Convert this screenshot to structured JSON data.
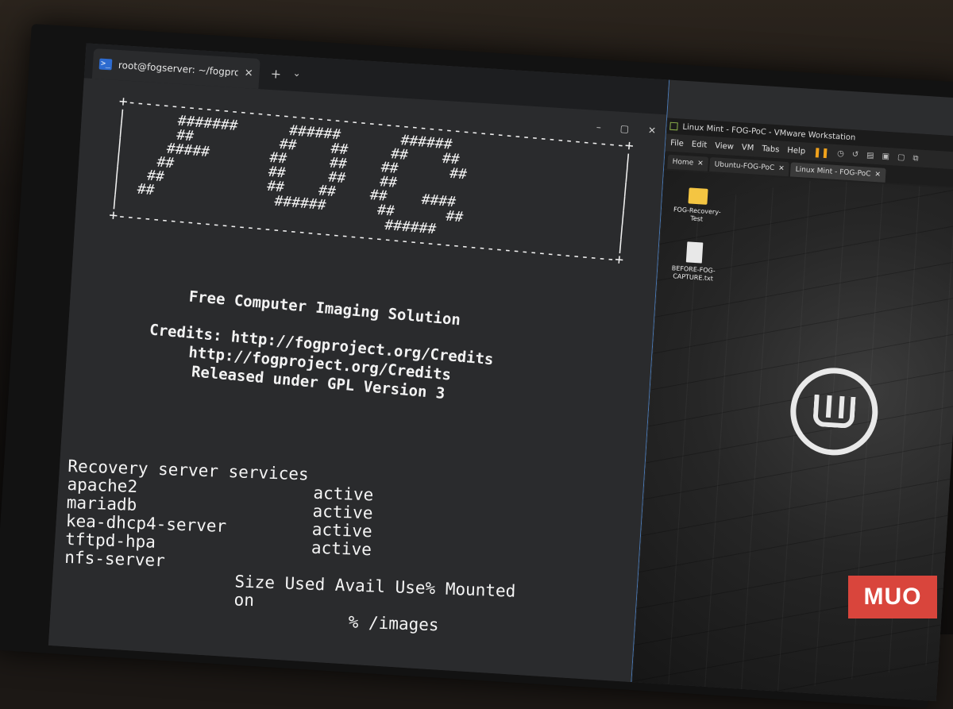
{
  "terminal": {
    "tab_title": "root@fogserver: ~/fogproject",
    "tab_close": "✕",
    "new_tab": "+",
    "tab_dropdown": "⌄",
    "controls": [
      "–",
      "▢",
      "✕"
    ],
    "banner": [
      "+----------------------------------------------------------+",
      "|      #######      ######       ######                    |",
      "|      ##          ##    ##     ##    ##                   |",
      "|     #####       ##     ##    ##      ##                  |",
      "|    ##           ##     ##    ##                          |",
      "|   ##            ##    ##    ##    ####                   |",
      "|  ##              ######      ##      ##                  |",
      "|                               ######                     |",
      "+----------------------------------------------------------+"
    ],
    "tagline": "Free Computer Imaging Solution",
    "credits": [
      "Credits: http://fogproject.org/Credits",
      "http://fogproject.org/Credits",
      "Released under GPL Version 3"
    ],
    "services_title": "Recovery server services",
    "services": [
      {
        "name": "apache2",
        "status": "active"
      },
      {
        "name": "mariadb",
        "status": "active"
      },
      {
        "name": "kea-dhcp4-server",
        "status": "active"
      },
      {
        "name": "tftpd-hpa",
        "status": "active"
      },
      {
        "name": "nfs-server",
        "status": ""
      }
    ],
    "df_header": "Size  Used Avail Use% Mounted on",
    "df_partial": "%  /images"
  },
  "vmware": {
    "title": "Linux Mint - FOG-PoC - VMware Workstation",
    "menu": [
      "File",
      "Edit",
      "View",
      "VM",
      "Tabs",
      "Help"
    ],
    "pause_icon": "❚❚",
    "toolbar_icons": [
      "snapshot-icon",
      "revert-icon",
      "manager-icon",
      "fullscreen-icon",
      "unity-icon",
      "view-icon"
    ],
    "tabs": [
      {
        "label": "Home",
        "close": "✕"
      },
      {
        "label": "Ubuntu-FOG-PoC",
        "close": "✕"
      },
      {
        "label": "Linux Mint - FOG-PoC",
        "close": "✕"
      }
    ],
    "desktop_icons": [
      {
        "label": "FOG-Recovery-Test",
        "type": "folder-icon"
      },
      {
        "label": "BEFORE-FOG-CAPTURE.txt",
        "type": "text-file-icon"
      }
    ]
  },
  "watermark": "MUO"
}
